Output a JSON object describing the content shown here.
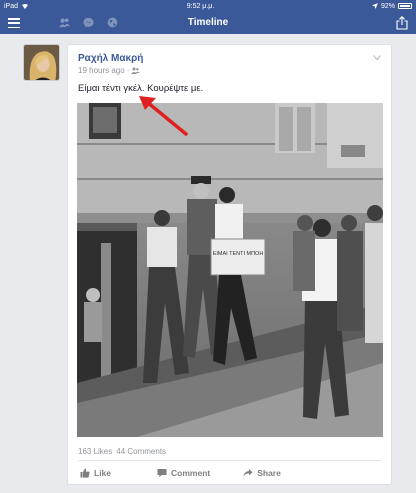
{
  "status_bar": {
    "device": "iPad",
    "time": "9:52 μ.μ.",
    "battery": "92%"
  },
  "navbar": {
    "title": "Timeline"
  },
  "post": {
    "author": "Ραχήλ Μακρή",
    "timestamp": "19 hours ago",
    "text": "Είμαι τέντι γκέλ. Κουρέψτε με.",
    "sign_text": "ΕΙΜΑΙ ΤΕΝΤΙ ΜΠΟΗ",
    "likes": "163 Likes",
    "comments": "44 Comments",
    "actions": {
      "like": "Like",
      "comment": "Comment",
      "share": "Share"
    }
  },
  "colors": {
    "brand": "#3b5998",
    "arrow": "#e02020"
  }
}
